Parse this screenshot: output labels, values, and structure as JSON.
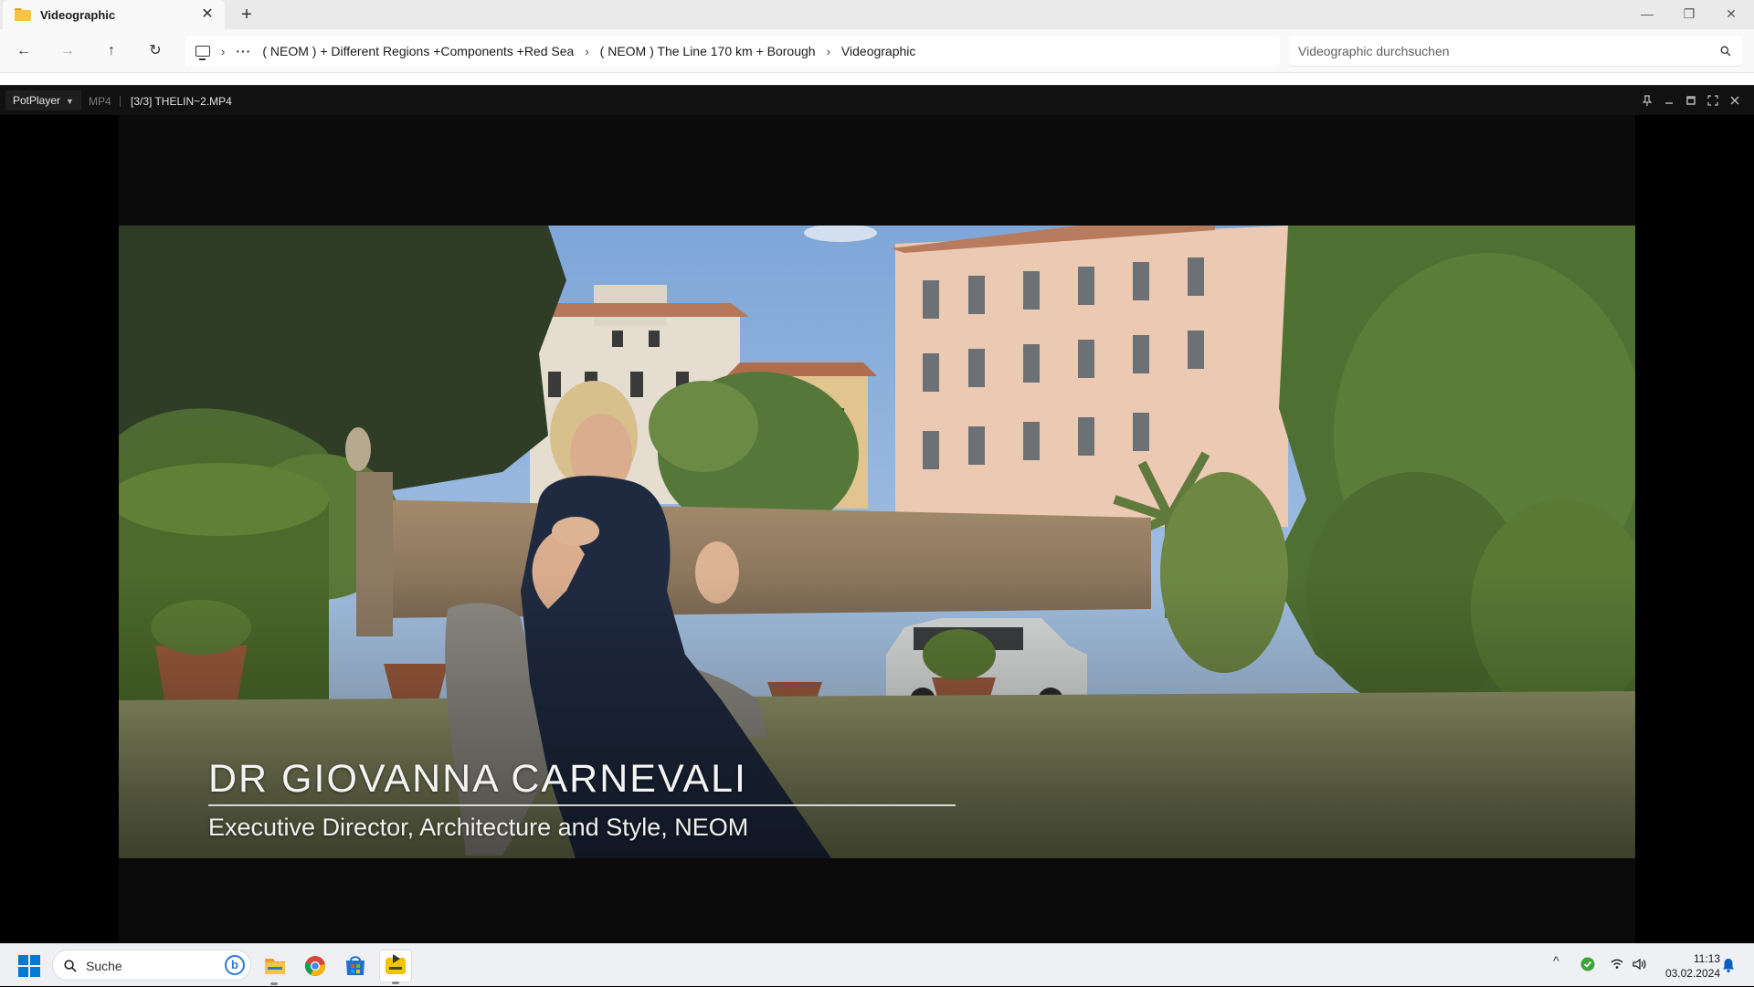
{
  "explorer": {
    "tab_title": "Videographic",
    "tab_close": "✕",
    "new_tab": "+",
    "window_controls": {
      "minimize": "—",
      "restore": "❐",
      "close": "✕"
    },
    "nav": {
      "back": "←",
      "forward": "→",
      "up": "↑",
      "refresh": "↻"
    },
    "breadcrumb_more": "···",
    "breadcrumb_sep": "›",
    "breadcrumbs": [
      "( NEOM ) + Different Regions +Components +Red Sea",
      "( NEOM ) The Line 170 km + Borough",
      "Videographic"
    ],
    "search_placeholder": "Videographic durchsuchen"
  },
  "potplayer": {
    "brand": "PotPlayer",
    "format": "MP4",
    "file": "[3/3] THELIN~2.MP4",
    "controls": [
      "pin-icon",
      "minimize-icon",
      "maximize-icon",
      "fullscreen-icon",
      "close-icon"
    ],
    "video": {
      "caption_name": "DR GIOVANNA CARNEVALI",
      "caption_role": "Executive Director, Architecture and Style, NEOM"
    }
  },
  "taskbar": {
    "search_label": "Suche",
    "bing_label": "b",
    "apps": [
      "file-explorer-icon",
      "chrome-icon",
      "store-icon",
      "potplayer-icon"
    ],
    "tray_chevron": "^",
    "time": "11:13",
    "date": "03.02.2024"
  },
  "colors": {
    "accent_blue": "#0078d4",
    "folder_yellow": "#f7c446",
    "potplayer_yellow": "#f5c400",
    "defender_green": "#3aa63a"
  }
}
